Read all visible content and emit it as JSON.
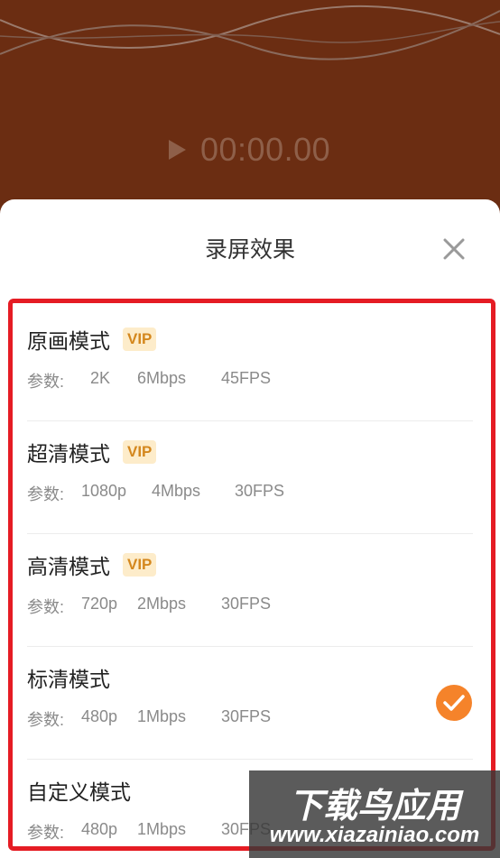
{
  "player": {
    "time": "00:00.00",
    "play_icon": "play-icon"
  },
  "sheet": {
    "title": "录屏效果",
    "close_icon": "close-icon"
  },
  "modes": [
    {
      "name": "原画模式",
      "vip": "VIP",
      "param_label": "参数:",
      "resolution": "2K",
      "bitrate": "6Mbps",
      "fps": "45FPS",
      "selected": false
    },
    {
      "name": "超清模式",
      "vip": "VIP",
      "param_label": "参数:",
      "resolution": "1080p",
      "bitrate": "4Mbps",
      "fps": "30FPS",
      "selected": false
    },
    {
      "name": "高清模式",
      "vip": "VIP",
      "param_label": "参数:",
      "resolution": "720p",
      "bitrate": "2Mbps",
      "fps": "30FPS",
      "selected": false
    },
    {
      "name": "标清模式",
      "vip": "",
      "param_label": "参数:",
      "resolution": "480p",
      "bitrate": "1Mbps",
      "fps": "30FPS",
      "selected": true
    },
    {
      "name": "自定义模式",
      "vip": "",
      "param_label": "参数:",
      "resolution": "480p",
      "bitrate": "1Mbps",
      "fps": "30FPS",
      "selected": false
    }
  ],
  "watermark": {
    "logo": "下载鸟应用",
    "url": "www.xiazainiao.com"
  },
  "colors": {
    "preview_bg": "#6b2d12",
    "accent_orange": "#f5832a",
    "vip_bg": "#fdecca",
    "vip_text": "#d4871d",
    "highlight_red": "#e51c24"
  }
}
